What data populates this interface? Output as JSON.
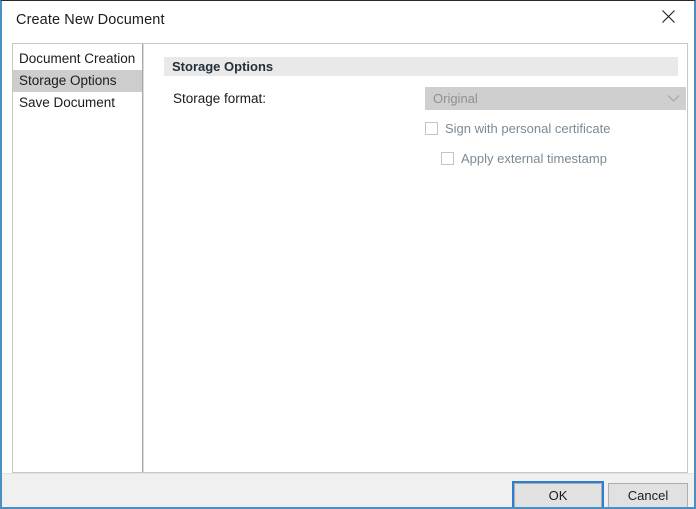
{
  "window": {
    "title": "Create New Document",
    "close_icon": "close-icon",
    "accent_border_color": "#4a90c4"
  },
  "sidebar": {
    "items": [
      {
        "label": "Document Creation",
        "selected": false
      },
      {
        "label": "Storage Options",
        "selected": true
      },
      {
        "label": "Save Document",
        "selected": false
      }
    ],
    "selected_background": "#cdcdcd"
  },
  "content": {
    "section_header": "Storage Options",
    "storage_format": {
      "label": "Storage format:",
      "value": "Original",
      "disabled": true,
      "arrow_icon": "chevron-down-icon",
      "background": "#cfcfcf",
      "text_color": "#909090"
    },
    "checkboxes": [
      {
        "label": "Sign with personal certificate",
        "checked": false,
        "disabled": true
      },
      {
        "label": "Apply external timestamp",
        "checked": false,
        "disabled": true
      }
    ]
  },
  "footer": {
    "ok_label": "OK",
    "cancel_label": "Cancel",
    "focus_color": "#2a7fd4",
    "background": "#f0f0f0"
  }
}
